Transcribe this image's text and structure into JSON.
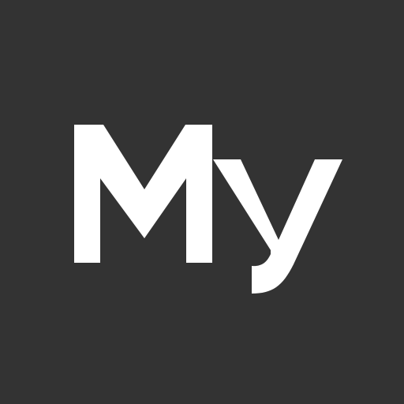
{
  "icon": {
    "logo_text": "My",
    "background_color": "#333333",
    "text_color": "#FFFFFF"
  }
}
